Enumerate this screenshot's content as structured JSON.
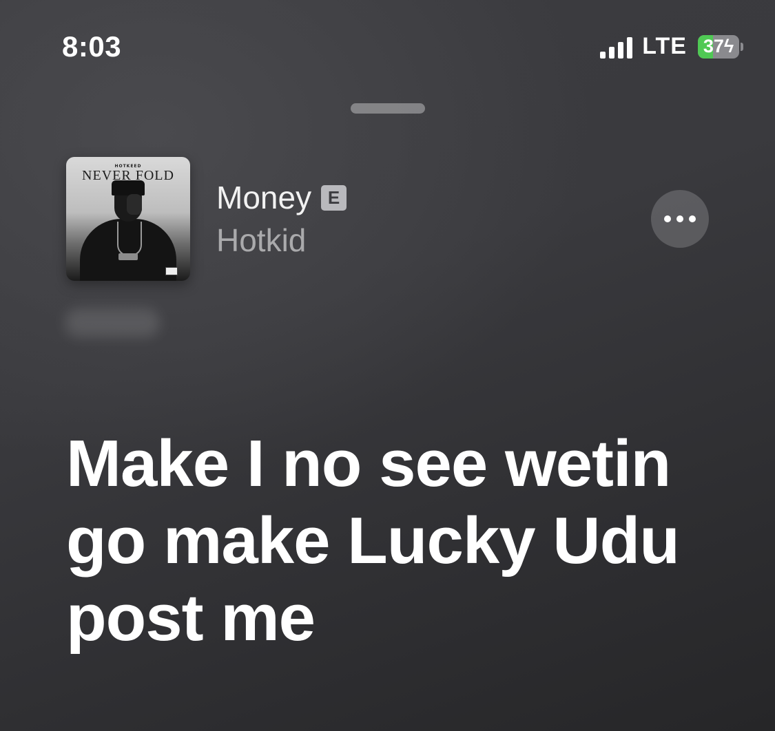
{
  "status_bar": {
    "time": "8:03",
    "network": "LTE",
    "battery_percent": "37",
    "battery_level": 0.37,
    "charging": true
  },
  "now_playing": {
    "song_title": "Money",
    "explicit_badge": "E",
    "artist": "Hotkid",
    "artwork": {
      "label_small": "HOTKEED",
      "label_title": "NEVER FOLD"
    }
  },
  "lyrics": {
    "current_lines": [
      "Make I no see wetin",
      "go make Lucky Udu",
      "post me"
    ]
  },
  "colors": {
    "battery_fill": "#4fc954",
    "background": "#3a3a3e"
  },
  "icons": {
    "more": "more-horizontal-icon",
    "signal": "cellular-signal-icon",
    "battery": "battery-charging-icon"
  }
}
